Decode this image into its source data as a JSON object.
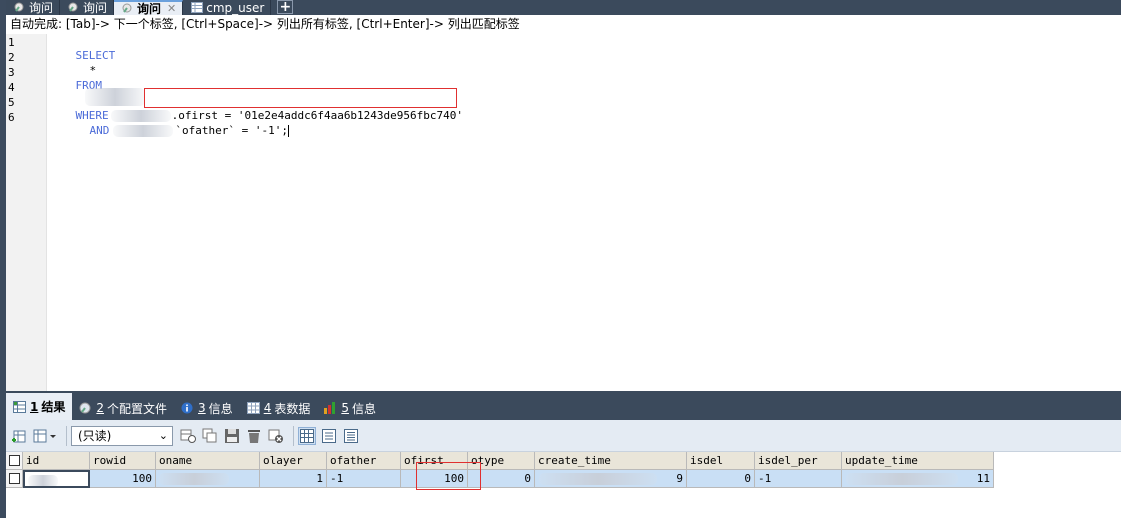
{
  "tabs": [
    {
      "label": "询问",
      "icon": "query-icon"
    },
    {
      "label": "询问",
      "icon": "query-icon"
    },
    {
      "label": "询问",
      "icon": "query-icon",
      "active": true
    },
    {
      "label": "cmp_user",
      "icon": "table-icon"
    }
  ],
  "new_tab": "+",
  "close_glyph": "✕",
  "hint": "自动完成: [Tab]-> 下一个标签, [Ctrl+Space]-> 列出所有标签, [Ctrl+Enter]-> 列出匹配标签",
  "editor": {
    "line_numbers": [
      "1",
      "2",
      "3",
      "4",
      "5",
      "6"
    ],
    "kw_select": "SELECT",
    "star": "*",
    "kw_from": "FROM",
    "kw_where": "WHERE",
    "where_cond": "ofirst = '01e2e4addc6f4aa6b1243de956fbc740'",
    "kw_and": "AND",
    "and_cond": "`ofather` = '-1';"
  },
  "result_tabs": [
    {
      "num": "1",
      "label": "结果",
      "icon": "grid-icon"
    },
    {
      "num": "2",
      "label": "个配置文件",
      "icon": "profile-icon"
    },
    {
      "num": "3",
      "label": "信息",
      "icon": "info-icon"
    },
    {
      "num": "4",
      "label": "表数据",
      "icon": "table-data-icon"
    },
    {
      "num": "5",
      "label": "信息",
      "icon": "info-chart-icon"
    }
  ],
  "toolbar": {
    "mode": "(只读)"
  },
  "grid": {
    "columns": [
      "id",
      "rowid",
      "oname",
      "olayer",
      "ofather",
      "ofirst",
      "otype",
      "create_time",
      "isdel",
      "isdel_per",
      "update_time"
    ],
    "row": {
      "id": "",
      "rowid": "100",
      "oname": "",
      "olayer": "1",
      "ofather": "-1",
      "ofirst": "100",
      "otype": "0",
      "create_time": "9",
      "isdel": "0",
      "isdel_per": "-1",
      "update_time": "11"
    }
  },
  "colors": {
    "keyword": "#4b6bd8",
    "string": "#d43b3b",
    "frame": "#3b4a5c",
    "highlight_box": "#e03030"
  }
}
